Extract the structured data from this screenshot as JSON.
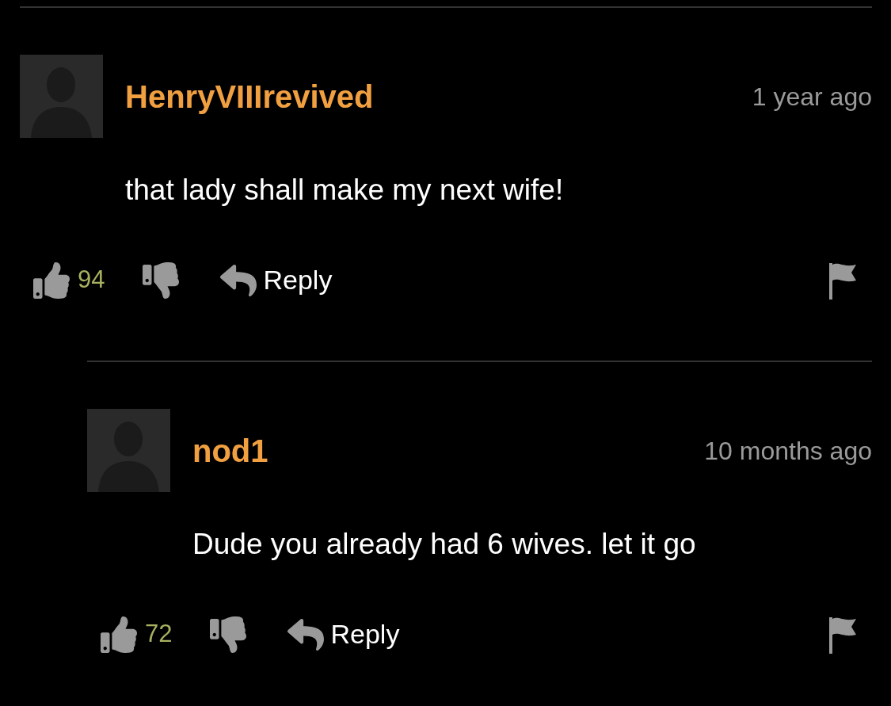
{
  "comments": [
    {
      "username": "HenryVIIIrevived",
      "time": "1 year ago",
      "text": "that lady shall make my next wife!",
      "likes": "94",
      "reply_label": "Reply",
      "children": [
        {
          "username": "nod1",
          "time": "10 months ago",
          "text": "Dude you already had 6 wives. let it go",
          "likes": "72",
          "reply_label": "Reply"
        }
      ]
    }
  ]
}
